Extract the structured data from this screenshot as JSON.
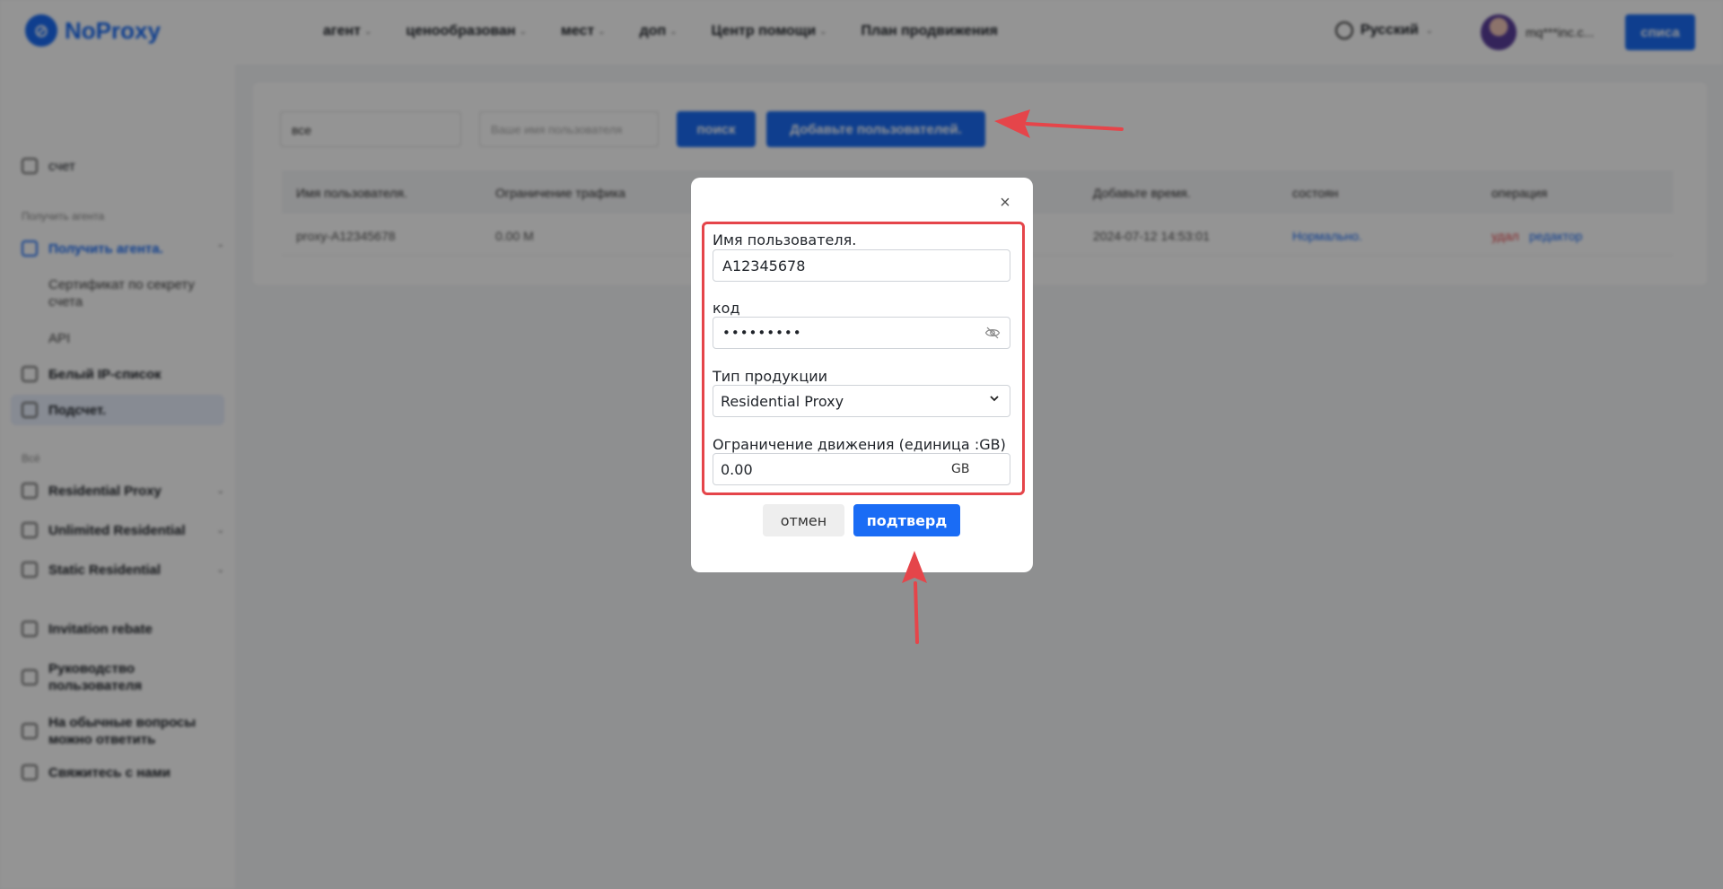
{
  "header": {
    "logo_text": "NoProxy",
    "nav": [
      "агент",
      "ценообразован",
      "мест",
      "доп",
      "Центр помощи",
      "План продвижения"
    ],
    "language": "Русский",
    "user_name": "mq***inc.c...",
    "top_button": "списа"
  },
  "sidebar": {
    "account": "счет",
    "section_get_agent": "Получить агента",
    "get_agent": "Получить агента.",
    "secret_cert": "Сертификат по секрету счета",
    "api": "API",
    "whitelist": "Белый IP-список",
    "subaccount": "Подсчет.",
    "section_all": "Всё",
    "residential_proxy": "Residential Proxy",
    "unlimited_residential": "Unlimited Residential",
    "static_residential": "Static Residential",
    "invitation_rebate": "Invitation rebate",
    "user_guide": "Руководство пользователя",
    "faq": "На обычные вопросы можно ответить",
    "contact": "Свяжитесь с нами"
  },
  "main": {
    "filter_select": "все",
    "filter_placeholder": "Ваше имя пользователя",
    "search_button": "поиск",
    "add_users_button": "Добавьте пользователей.",
    "table": {
      "columns": [
        "Имя пользователя.",
        "Ограничение трафика",
        "Добавьте время.",
        "состоян",
        "операция"
      ],
      "row": {
        "username": "proxy-A12345678",
        "limit": "0.00 M",
        "added": "2024-07-12 14:53:01",
        "status": "Нормально.",
        "op_delete": "удал",
        "op_edit": "редактор"
      }
    }
  },
  "modal": {
    "close": "×",
    "username_label": "Имя пользователя.",
    "username_value": "A12345678",
    "password_label": "код",
    "password_value": "•••••••••",
    "product_label": "Тип продукции",
    "product_value": "Residential Proxy",
    "traffic_label": "Ограничение движения (единица :GB)",
    "traffic_value": "0.00",
    "traffic_unit": "GB",
    "cancel": "отмен",
    "confirm": "подтверд"
  },
  "colors": {
    "accent": "#1a6cf5",
    "annotation_red": "#e5454a"
  }
}
